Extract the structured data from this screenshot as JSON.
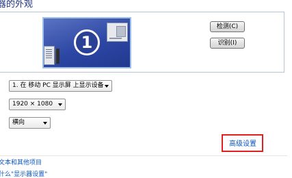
{
  "header": {
    "title": "器的外观"
  },
  "display": {
    "monitor_number": "1",
    "detect_button": "检测(C)",
    "identify_button": "识别(I)"
  },
  "settings": {
    "display_select": "1. 在 移动 PC 显示屏 上显示设备",
    "resolution_select": "1920 × 1080",
    "orientation_select": "横向"
  },
  "links": {
    "advanced_settings": "高级设置",
    "text_and_items": "文本和其他项目",
    "partial_link": "什么\"显示器设置\""
  }
}
